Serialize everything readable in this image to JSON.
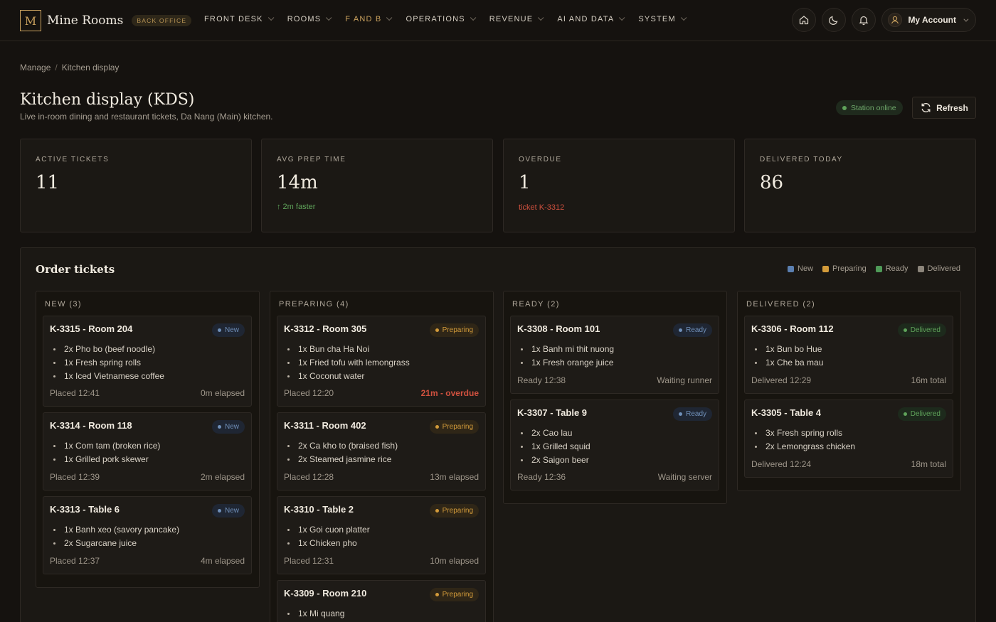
{
  "brand": {
    "mark": "M",
    "name": "Mine Rooms",
    "badge": "BACK OFFICE"
  },
  "nav": [
    {
      "label": "FRONT DESK",
      "active": false
    },
    {
      "label": "ROOMS",
      "active": false
    },
    {
      "label": "F AND B",
      "active": true
    },
    {
      "label": "OPERATIONS",
      "active": false
    },
    {
      "label": "REVENUE",
      "active": false
    },
    {
      "label": "AI AND DATA",
      "active": false
    },
    {
      "label": "SYSTEM",
      "active": false
    }
  ],
  "account": {
    "label": "My Account"
  },
  "icons": {
    "home": "home-icon",
    "theme": "moon-icon",
    "notifications": "bell-icon",
    "avatar": "user-icon",
    "refresh": "refresh-icon"
  },
  "colors": {
    "accent": "#c9a15e",
    "new": "#5b7fb0",
    "preparing": "#d39b3a",
    "ready": "#4f9a58",
    "delivered": "#8c857b",
    "overdue": "#d0513f"
  },
  "breadcrumb": {
    "parent": "Manage",
    "separator": "/",
    "current": "Kitchen display"
  },
  "header": {
    "title": "Kitchen display (KDS)",
    "subtitle": "Live in-room dining and restaurant tickets, Da Nang (Main) kitchen.",
    "status": "Station online",
    "refresh_label": "Refresh"
  },
  "stats": [
    {
      "label": "ACTIVE TICKETS",
      "value": "11",
      "note": "",
      "note_type": ""
    },
    {
      "label": "AVG PREP TIME",
      "value": "14m",
      "note": "↑ 2m faster",
      "note_type": "good"
    },
    {
      "label": "OVERDUE",
      "value": "1",
      "note": "ticket K-3312",
      "note_type": "bad"
    },
    {
      "label": "DELIVERED TODAY",
      "value": "86",
      "note": "",
      "note_type": ""
    }
  ],
  "board": {
    "title": "Order tickets",
    "legend": [
      {
        "label": "New",
        "color": "#5b7fb0"
      },
      {
        "label": "Preparing",
        "color": "#d39b3a"
      },
      {
        "label": "Ready",
        "color": "#4f9a58"
      },
      {
        "label": "Delivered",
        "color": "#8c857b"
      }
    ],
    "columns": [
      {
        "title": "NEW (3)",
        "tickets": [
          {
            "title": "K-3315 - Room 204",
            "status": "New",
            "items": [
              "2x Pho bo (beef noodle)",
              "1x Fresh spring rolls",
              "1x Iced Vietnamese coffee"
            ],
            "footer_left": "Placed 12:41",
            "footer_right": "0m elapsed"
          },
          {
            "title": "K-3314 - Room 118",
            "status": "New",
            "items": [
              "1x Com tam (broken rice)",
              "1x Grilled pork skewer"
            ],
            "footer_left": "Placed 12:39",
            "footer_right": "2m elapsed"
          },
          {
            "title": "K-3313 - Table 6",
            "status": "New",
            "items": [
              "1x Banh xeo (savory pancake)",
              "2x Sugarcane juice"
            ],
            "footer_left": "Placed 12:37",
            "footer_right": "4m elapsed"
          }
        ]
      },
      {
        "title": "PREPARING (4)",
        "tickets": [
          {
            "title": "K-3312 - Room 305",
            "status": "Preparing",
            "items": [
              "1x Bun cha Ha Noi",
              "1x Fried tofu with lemongrass",
              "1x Coconut water"
            ],
            "footer_left": "Placed 12:20",
            "footer_right": "21m - overdue"
          },
          {
            "title": "K-3311 - Room 402",
            "status": "Preparing",
            "items": [
              "2x Ca kho to (braised fish)",
              "2x Steamed jasmine rice"
            ],
            "footer_left": "Placed 12:28",
            "footer_right": "13m elapsed"
          },
          {
            "title": "K-3310 - Table 2",
            "status": "Preparing",
            "items": [
              "1x Goi cuon platter",
              "1x Chicken pho"
            ],
            "footer_left": "Placed 12:31",
            "footer_right": "10m elapsed"
          },
          {
            "title": "K-3309 - Room 210",
            "status": "Preparing",
            "items": [
              "1x Mi quang"
            ],
            "footer_left": "",
            "footer_right": ""
          }
        ]
      },
      {
        "title": "READY (2)",
        "tickets": [
          {
            "title": "K-3308 - Room 101",
            "status": "Ready",
            "items": [
              "1x Banh mi thit nuong",
              "1x Fresh orange juice"
            ],
            "footer_left": "Ready 12:38",
            "footer_right": "Waiting runner"
          },
          {
            "title": "K-3307 - Table 9",
            "status": "Ready",
            "items": [
              "2x Cao lau",
              "1x Grilled squid",
              "2x Saigon beer"
            ],
            "footer_left": "Ready 12:36",
            "footer_right": "Waiting server"
          }
        ]
      },
      {
        "title": "DELIVERED (2)",
        "tickets": [
          {
            "title": "K-3306 - Room 112",
            "status": "Delivered",
            "items": [
              "1x Bun bo Hue",
              "1x Che ba mau"
            ],
            "footer_left": "Delivered 12:29",
            "footer_right": "16m total"
          },
          {
            "title": "K-3305 - Table 4",
            "status": "Delivered",
            "items": [
              "3x Fresh spring rolls",
              "2x Lemongrass chicken"
            ],
            "footer_left": "Delivered 12:24",
            "footer_right": "18m total"
          }
        ]
      }
    ]
  }
}
